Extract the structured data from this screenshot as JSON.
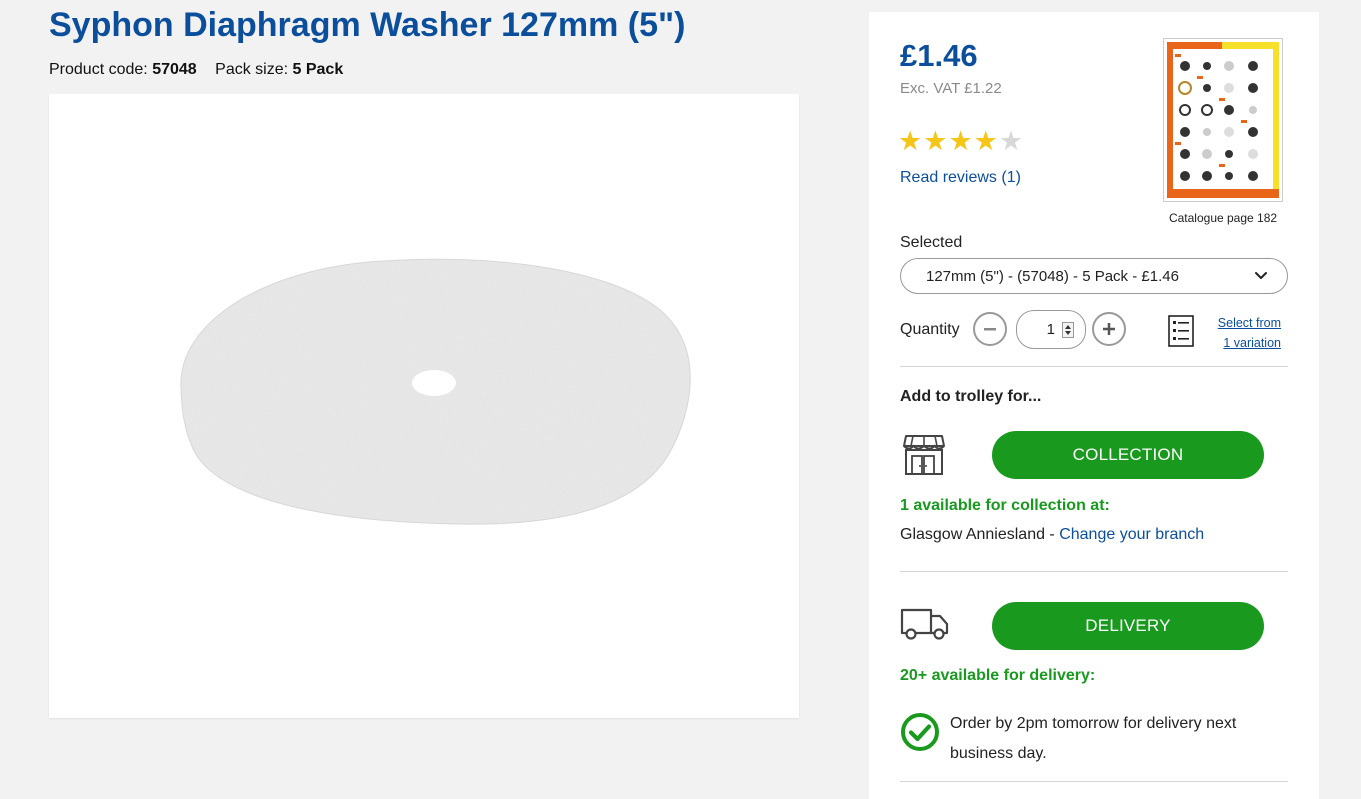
{
  "product": {
    "title": "Syphon Diaphragm Washer 127mm (5\")",
    "code_label": "Product code:",
    "code": "57048",
    "pack_label": "Pack size:",
    "pack": "5 Pack"
  },
  "pricing": {
    "price": "£1.46",
    "ex_vat": "Exc. VAT £1.22"
  },
  "rating": {
    "stars_filled": 4,
    "stars_total": 5,
    "reviews_link": "Read reviews (1)"
  },
  "catalogue": {
    "caption": "Catalogue page 182"
  },
  "variant": {
    "label": "Selected",
    "selected": "127mm (5\") - (57048) - 5 Pack - £1.46"
  },
  "quantity": {
    "label": "Quantity",
    "value": "1"
  },
  "variations": {
    "line1": "Select from",
    "line2": "1 variation"
  },
  "trolley": {
    "heading": "Add to trolley for...",
    "collection_button": "COLLECTION",
    "collection_availability": "1 available for collection at:",
    "branch": "Glasgow Anniesland",
    "branch_separator": " - ",
    "change_branch": "Change your branch",
    "delivery_button": "DELIVERY",
    "delivery_availability": "20+ available for delivery:",
    "delivery_note": "Order by 2pm tomorrow for delivery next business day."
  },
  "colors": {
    "brand_blue": "#0b4f9c",
    "action_green": "#199a1f",
    "star_gold": "#f5c518"
  }
}
